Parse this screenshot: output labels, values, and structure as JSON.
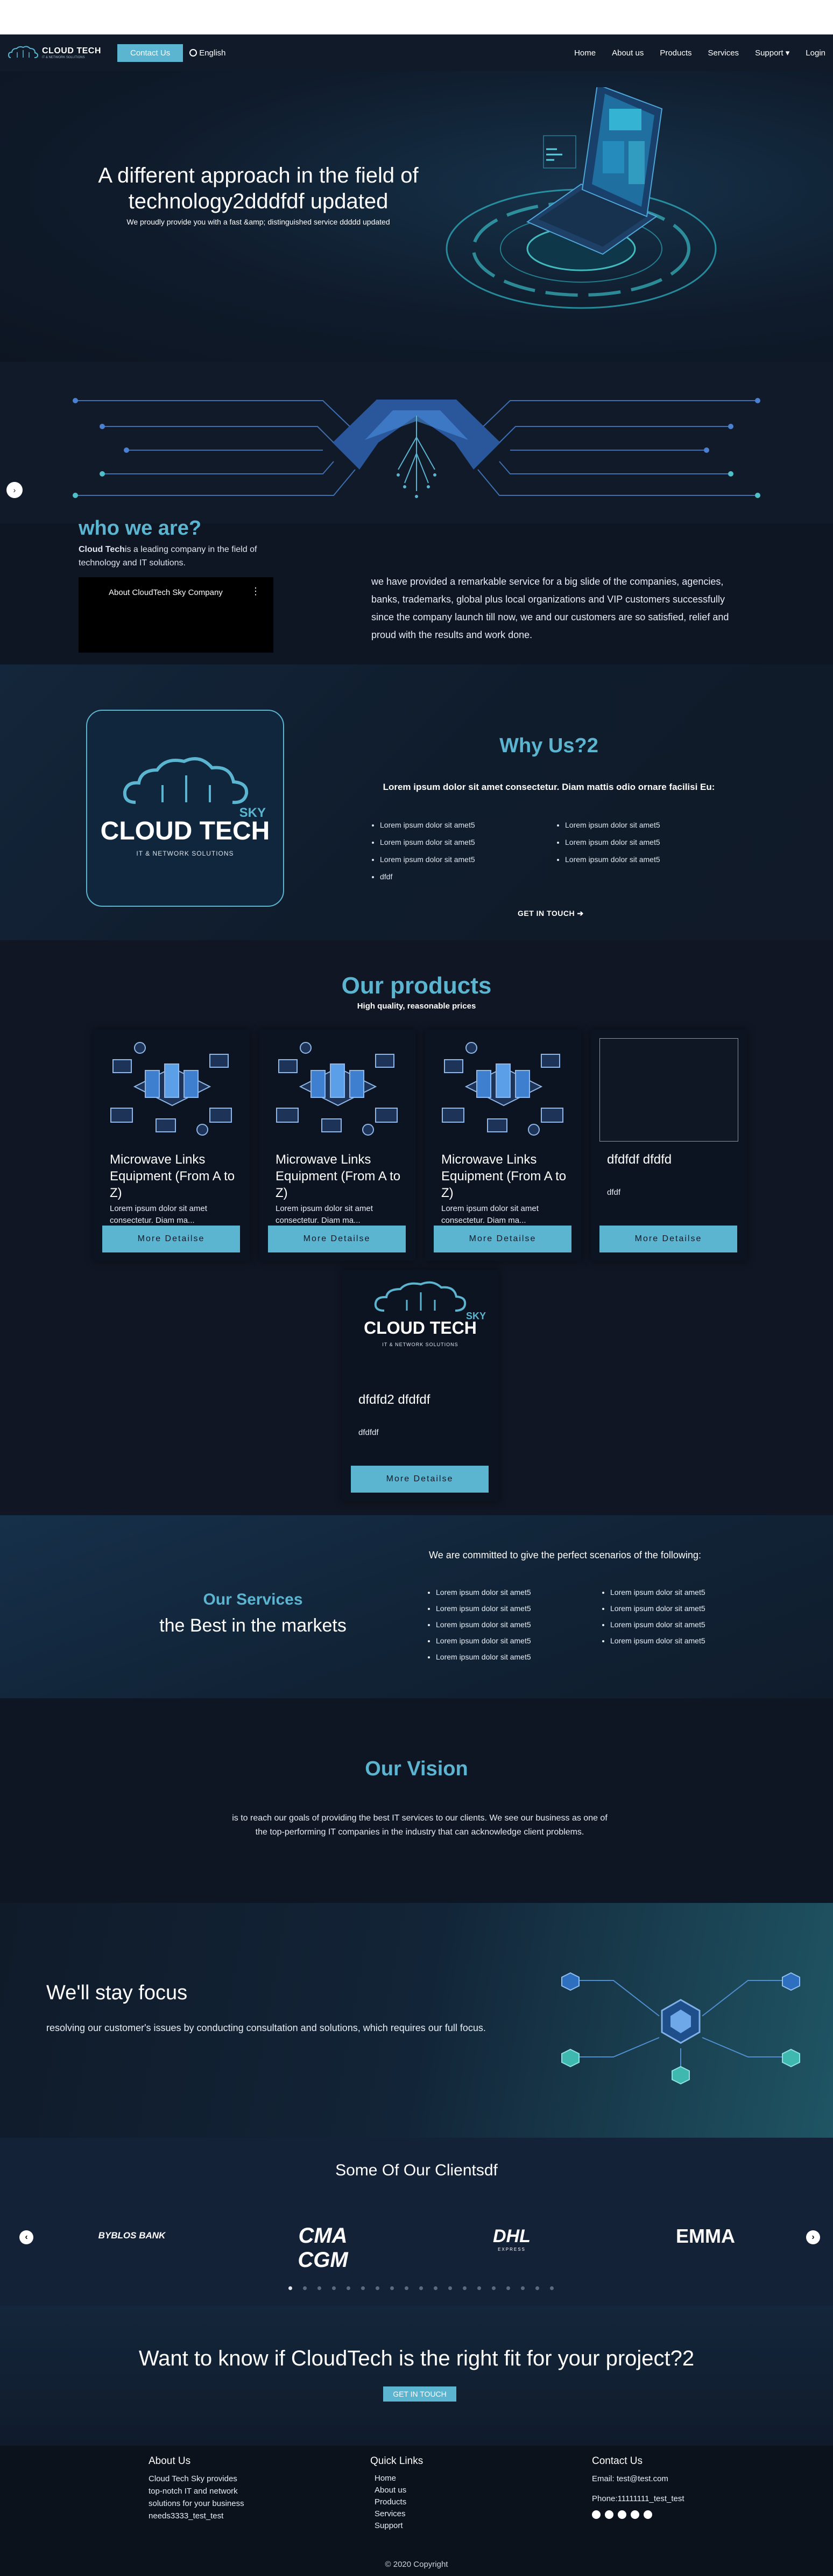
{
  "nav": {
    "logo_text": "CLOUD TECH",
    "logo_sub": "IT & NETWORK SOLUTIONS",
    "contact_label": "Contact Us",
    "language": "English",
    "links": [
      "Home",
      "About us",
      "Products",
      "Services",
      "Support ▾",
      "Login"
    ]
  },
  "hero": {
    "title": "A different approach in the field of technology2dddfdf updated",
    "subtitle": "We proudly provide you with a fast &amp; distinguished service ddddd updated"
  },
  "side_toggle": "›",
  "who": {
    "title": "who we are?",
    "sub_bold": "Cloud Tech",
    "sub_rest": "is a leading company in the field of technology and IT solutions.",
    "video_title": "About CloudTech Sky Company",
    "video_menu": "⋮",
    "text": "we have provided a remarkable service for a big slide of the companies, agencies, banks, trademarks, global plus local organizations and VIP customers successfully since the company launch till now, we and our customers are so satisfied, relief and proud with the results and work done."
  },
  "why": {
    "logo_brand": "CLOUD TECH",
    "logo_sky": "SKY",
    "logo_tag": "IT & NETWORK SOLUTIONS",
    "title": "Why Us?2",
    "lead": "Lorem ipsum dolor sit amet consectetur. Diam mattis odio ornare facilisi Eu:",
    "list_left": [
      "Lorem ipsum dolor sit amet5",
      "Lorem ipsum dolor sit amet5",
      "Lorem ipsum dolor sit amet5",
      "dfdf"
    ],
    "list_right": [
      "Lorem ipsum dolor sit amet5",
      "Lorem ipsum dolor sit amet5",
      "Lorem ipsum dolor sit amet5"
    ],
    "cta": "GET IN TOUCH ➔"
  },
  "products": {
    "title": "Our products",
    "subtitle": "High quality, reasonable prices",
    "button_label": "More Detailse",
    "items": [
      {
        "name": "Microwave Links Equipment (From A to Z)",
        "desc": "Lorem ipsum dolor sit amet consectetur. Diam ma...",
        "image": "isometric-network-art"
      },
      {
        "name": "Microwave Links Equipment (From A to Z)",
        "desc": "Lorem ipsum dolor sit amet consectetur. Diam ma...",
        "image": "isometric-network-art"
      },
      {
        "name": "Microwave Links Equipment (From A to Z)",
        "desc": "Lorem ipsum dolor sit amet consectetur. Diam ma...",
        "image": "isometric-network-art"
      },
      {
        "name": "dfdfdf dfdfd",
        "desc": "dfdf",
        "image": "blank"
      },
      {
        "name": "dfdfd2 dfdfdf",
        "desc": "dfdfdf",
        "image": "cloud-tech-logo"
      }
    ],
    "logo_brand": "CLOUD TECH",
    "logo_sky": "SKY",
    "logo_tag": "IT & NETWORK SOLUTIONS"
  },
  "services": {
    "label": "Our Services",
    "best": "the Best in the markets",
    "lead": "We are committed to give the perfect scenarios of the following:",
    "list_left": [
      "Lorem ipsum dolor sit amet5",
      "Lorem ipsum dolor sit amet5",
      "Lorem ipsum dolor sit amet5",
      "Lorem ipsum dolor sit amet5",
      "Lorem ipsum dolor sit amet5"
    ],
    "list_right": [
      "Lorem ipsum dolor sit amet5",
      "Lorem ipsum dolor sit amet5",
      "Lorem ipsum dolor sit amet5",
      "Lorem ipsum dolor sit amet5"
    ]
  },
  "vision": {
    "title": "Our Vision",
    "text": "is to reach our goals of providing the best IT services to our clients. We see our business as one of the top-performing IT companies in the industry that can acknowledge client problems."
  },
  "focus": {
    "title": "We'll stay focus",
    "text": "resolving our customer's issues by conducting consultation and solutions, which requires our full focus."
  },
  "clients": {
    "title": "Some Of Our Clientsdf",
    "logos": [
      "BYBLOS BANK",
      "CMA CGM",
      "DHL",
      "EMMA"
    ],
    "dhl_sub": "EXPRESS",
    "prev": "‹",
    "next": "›",
    "dot_count": 19,
    "active_dot": 0
  },
  "cta": {
    "title": "Want to know if CloudTech is the right fit for your project?2",
    "button": "GET IN TOUCH"
  },
  "footer": {
    "about_title": "About Us",
    "about_text": "Cloud Tech Sky provides top-notch IT and network solutions for your business needs3333_test_test",
    "links_title": "Quick Links",
    "links": [
      "Home",
      "About us",
      "Products",
      "Services",
      "Support"
    ],
    "contact_title": "Contact Us",
    "email": "Email: test@test.com",
    "phone": "Phone:11111111_test_test",
    "social": [
      "facebook-icon",
      "twitter-icon",
      "linkedin-icon",
      "instagram-icon",
      "youtube-icon"
    ],
    "copyright": "© 2020 Copyright"
  },
  "colors": {
    "accent": "#5bb4d0",
    "background": "#0f1623",
    "card": "#0d1421"
  }
}
